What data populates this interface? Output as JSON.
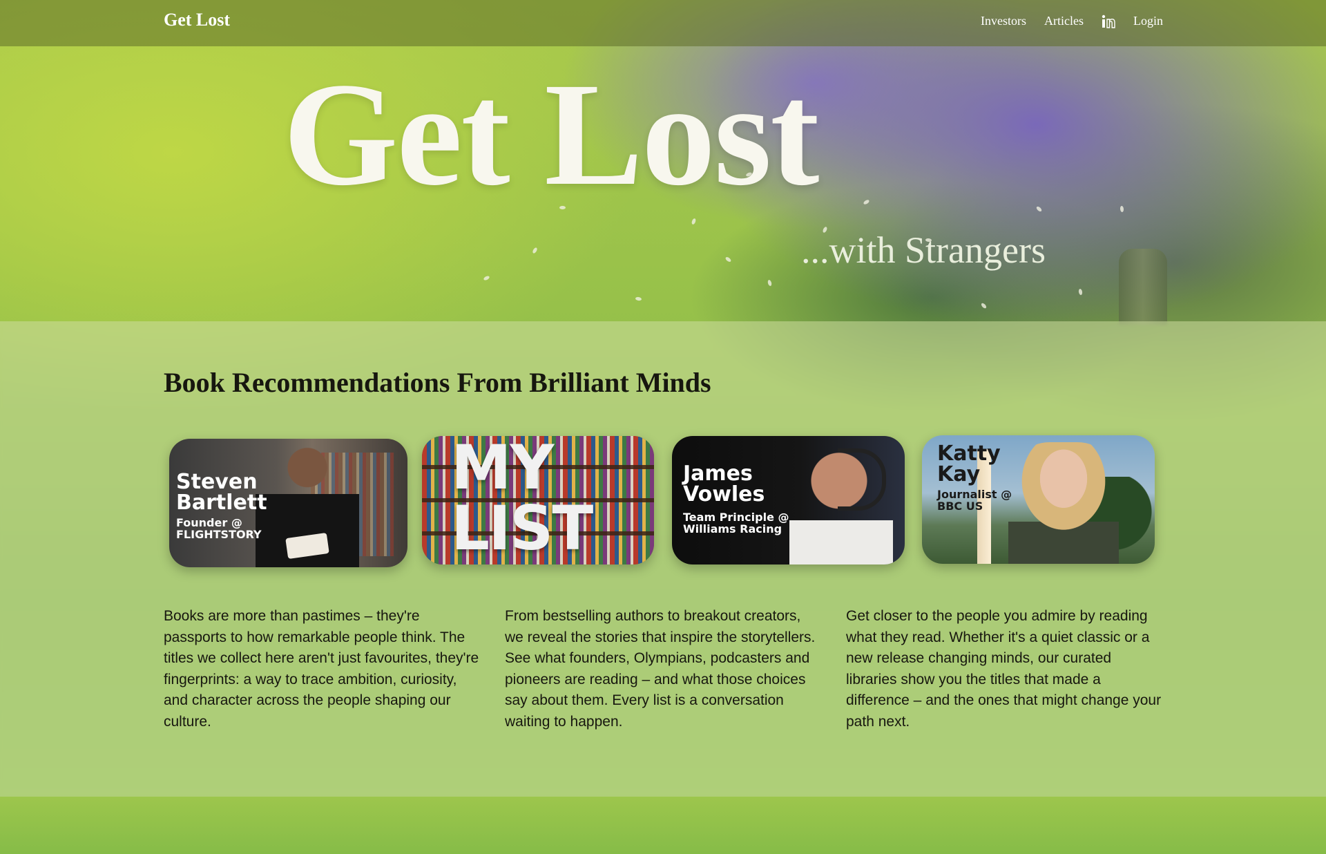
{
  "nav": {
    "brand": "Get Lost",
    "links": [
      "Investors",
      "Articles",
      "Login"
    ],
    "linkedin_icon": "linkedin-icon"
  },
  "hero": {
    "title": "Get Lost",
    "subtitle": "...with Strangers"
  },
  "section": {
    "title": "Book Recommendations From Brilliant Minds"
  },
  "cards": [
    {
      "name": "Steven\nBartlett",
      "role": "Founder @\nFLIGHTSTORY"
    },
    {
      "name": "MY\nLIST",
      "role": ""
    },
    {
      "name": "James\nVowles",
      "role": "Team Principle @\nWilliams Racing"
    },
    {
      "name": "Katty\nKay",
      "role": "Journalist @\nBBC US"
    }
  ],
  "paragraphs": [
    "Books are more than pastimes – they're passports to how remarkable people think. The titles we collect here aren't just favourites, they're fingerprints: a way to trace ambition, curiosity, and character across the people shaping our culture.",
    "From bestselling authors to breakout creators, we reveal the stories that inspire the storytellers. See what founders, Olympians, podcasters and pioneers are reading – and what those choices say about them. Every list is a conversation waiting to happen.",
    "Get closer to the people you admire by reading what they read. Whether it's a quiet classic or a new release changing minds, our curated libraries show you the titles that made a difference – and the ones that might change your path next."
  ],
  "colors": {
    "nav_bg": "#5f6e28",
    "hero_text": "#f8f7ee",
    "body_text": "#17170f",
    "grass": "#8fb84a",
    "blossom": "#7864be"
  }
}
